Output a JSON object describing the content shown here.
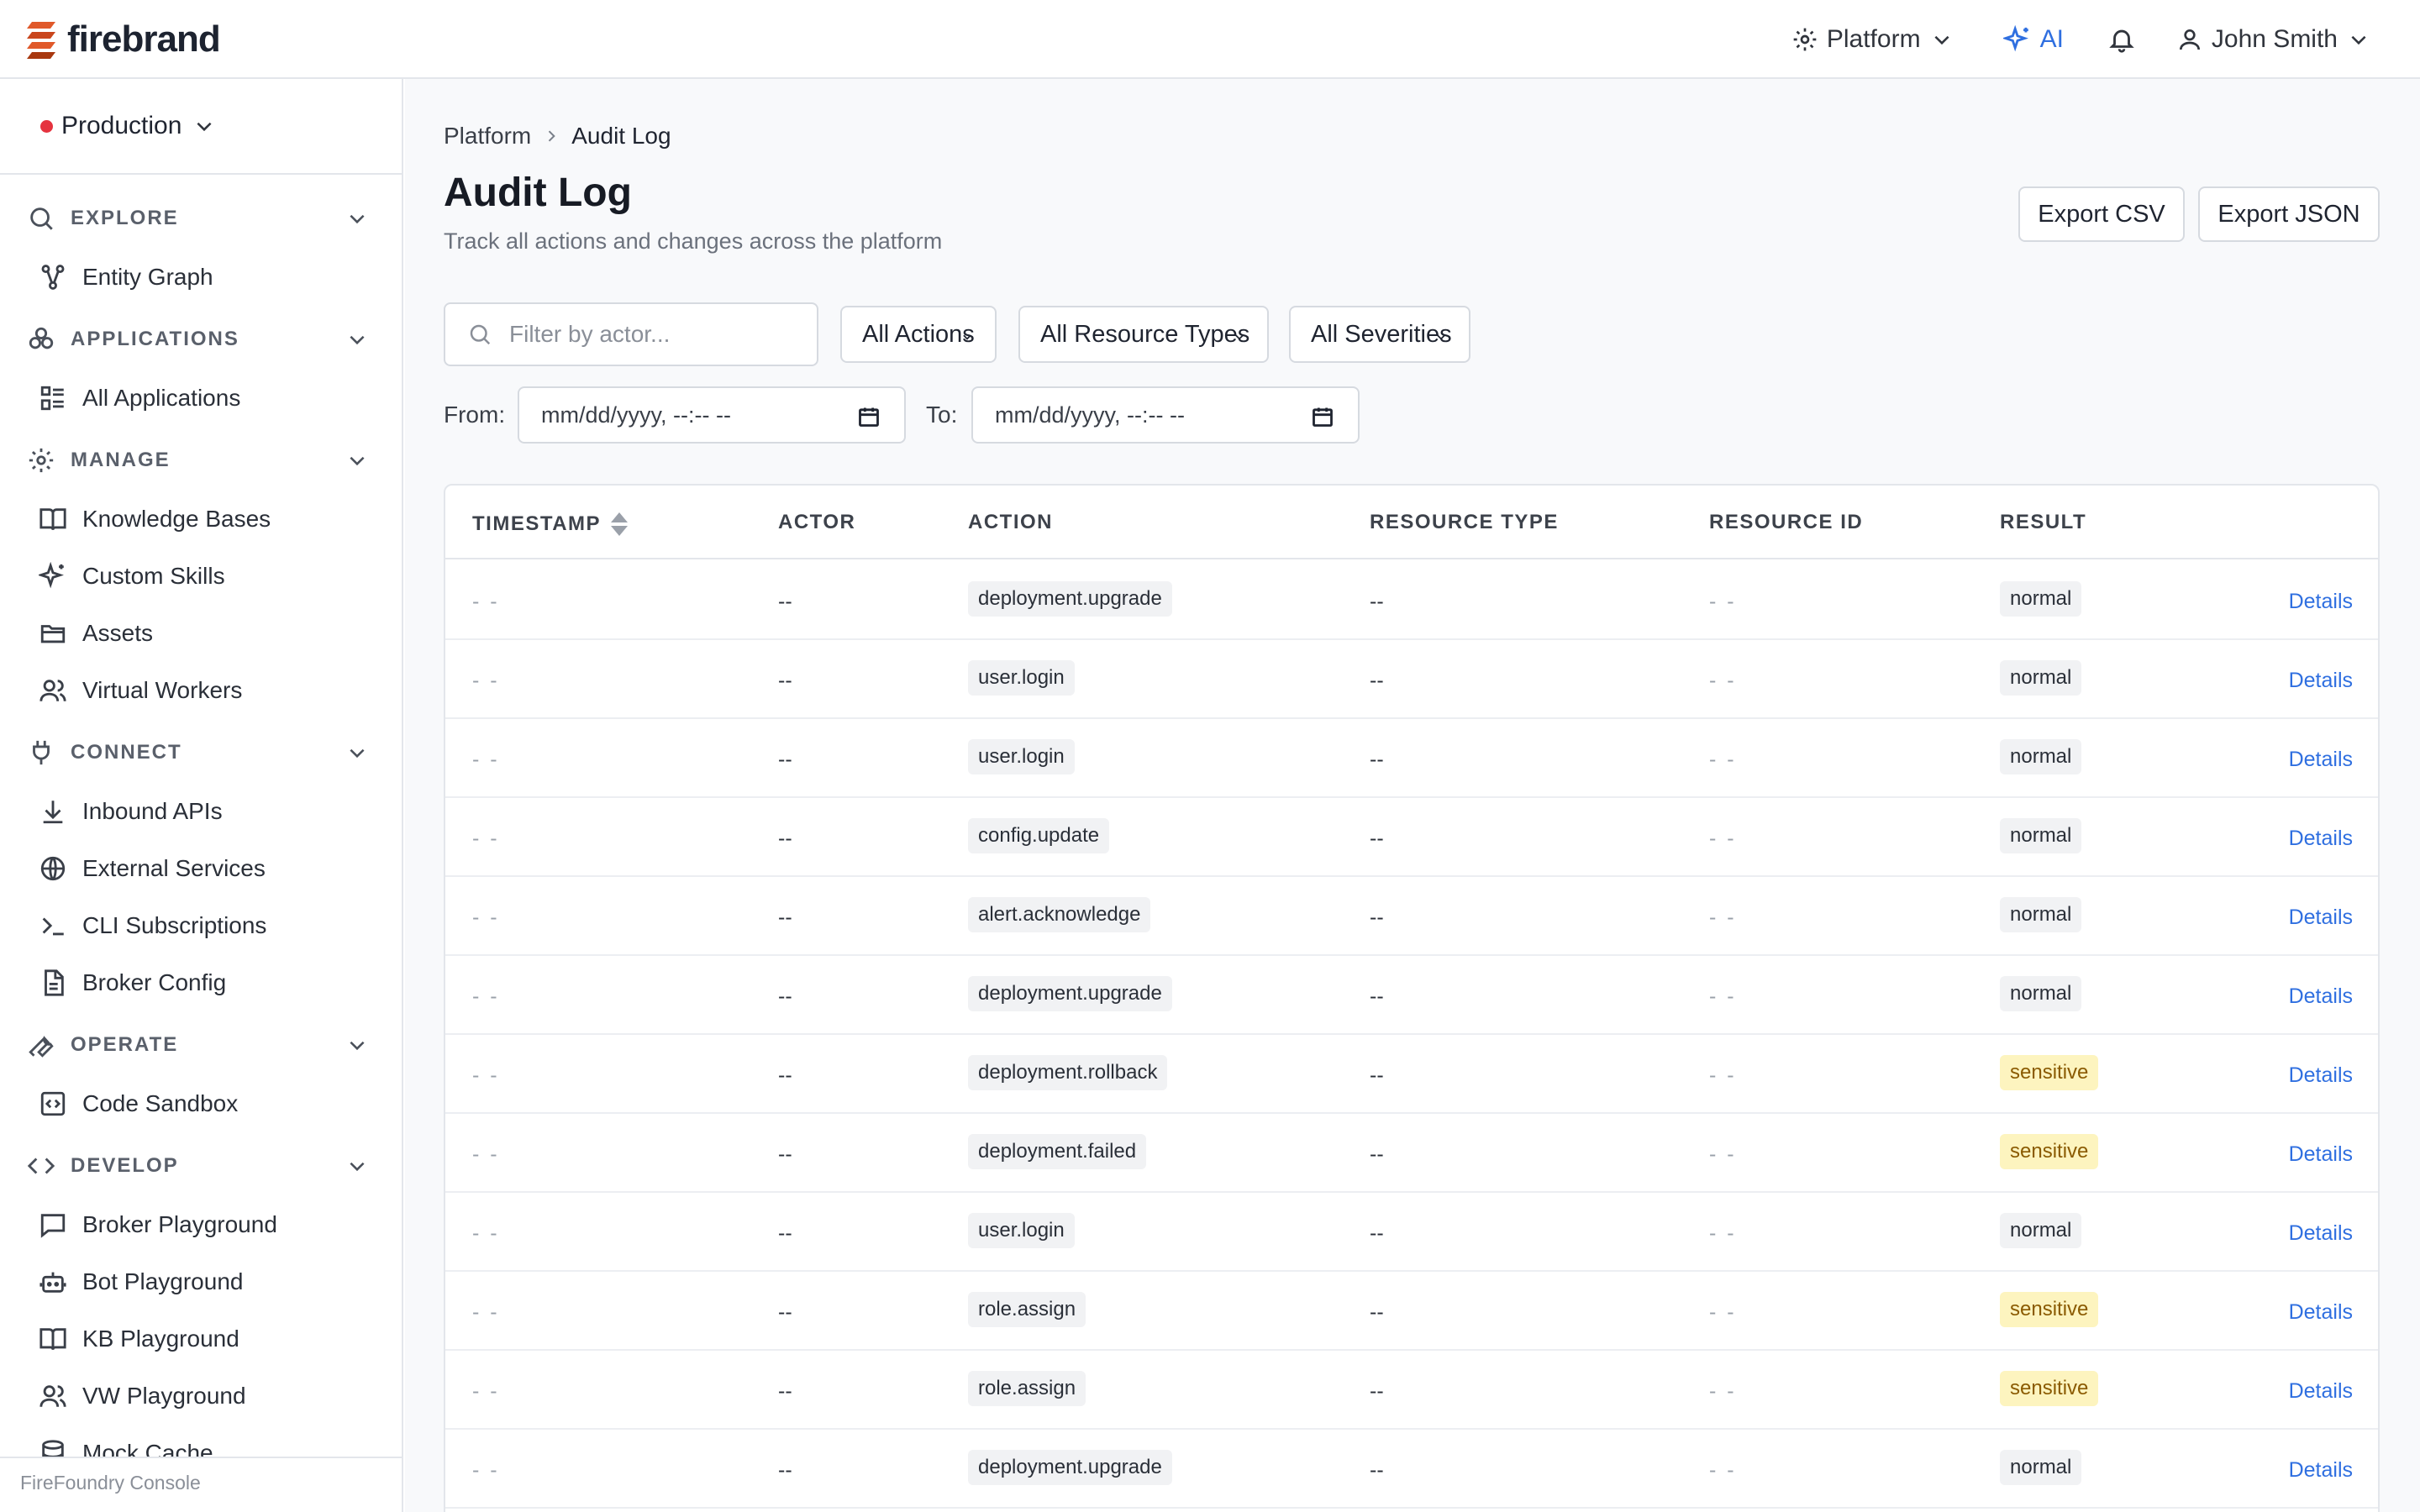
{
  "app": {
    "brand": "firebrand",
    "colors": {
      "accent": "#2f6fe0",
      "brand": "#e0592a",
      "env_dot": "#e5333f",
      "sensitive_bg": "#fdf4bf"
    }
  },
  "topbar": {
    "platform_label": "Platform",
    "ai_label": "AI",
    "user_name": "John Smith"
  },
  "sidebar": {
    "environment": "Production",
    "sections": [
      {
        "label": "EXPLORE",
        "icon": "search-icon",
        "items": [
          {
            "label": "Entity Graph",
            "icon": "graph-icon"
          }
        ]
      },
      {
        "label": "APPLICATIONS",
        "icon": "apps-icon",
        "items": [
          {
            "label": "All Applications",
            "icon": "list-icon"
          }
        ]
      },
      {
        "label": "MANAGE",
        "icon": "gear-icon",
        "items": [
          {
            "label": "Knowledge Bases",
            "icon": "book-icon"
          },
          {
            "label": "Custom Skills",
            "icon": "sparkle-icon"
          },
          {
            "label": "Assets",
            "icon": "folder-icon"
          },
          {
            "label": "Virtual Workers",
            "icon": "users-icon"
          }
        ]
      },
      {
        "label": "CONNECT",
        "icon": "plug-icon",
        "items": [
          {
            "label": "Inbound APIs",
            "icon": "download-icon"
          },
          {
            "label": "External Services",
            "icon": "globe-icon"
          },
          {
            "label": "CLI Subscriptions",
            "icon": "terminal-icon"
          },
          {
            "label": "Broker Config",
            "icon": "file-icon"
          }
        ]
      },
      {
        "label": "OPERATE",
        "icon": "wrench-icon",
        "items": [
          {
            "label": "Code Sandbox",
            "icon": "code-box-icon"
          }
        ]
      },
      {
        "label": "DEVELOP",
        "icon": "code-icon",
        "items": [
          {
            "label": "Broker Playground",
            "icon": "chat-icon"
          },
          {
            "label": "Bot Playground",
            "icon": "bot-icon"
          },
          {
            "label": "KB Playground",
            "icon": "book-icon"
          },
          {
            "label": "VW Playground",
            "icon": "users-icon"
          },
          {
            "label": "Mock Cache",
            "icon": "database-icon"
          }
        ]
      }
    ],
    "footer": "FireFoundry Console"
  },
  "main": {
    "breadcrumb": [
      "Platform",
      "Audit Log"
    ],
    "title": "Audit Log",
    "subtitle": "Track all actions and changes across the platform",
    "export_csv": "Export CSV",
    "export_json": "Export JSON",
    "filters": {
      "actor_placeholder": "Filter by actor...",
      "action": "All Actions",
      "resource_type": "All Resource Types",
      "severity": "All Severities",
      "from_label": "From:",
      "to_label": "To:",
      "date_placeholder": "mm/dd/yyyy, --:-- --"
    },
    "table": {
      "columns": [
        "TIMESTAMP",
        "ACTOR",
        "ACTION",
        "RESOURCE TYPE",
        "RESOURCE ID",
        "RESULT"
      ],
      "details_label": "Details",
      "rows": [
        {
          "timestamp": "- -",
          "actor": "--",
          "action": "deployment.upgrade",
          "resource_type": "--",
          "resource_id": "- -",
          "result": "normal"
        },
        {
          "timestamp": "- -",
          "actor": "--",
          "action": "user.login",
          "resource_type": "--",
          "resource_id": "- -",
          "result": "normal"
        },
        {
          "timestamp": "- -",
          "actor": "--",
          "action": "user.login",
          "resource_type": "--",
          "resource_id": "- -",
          "result": "normal"
        },
        {
          "timestamp": "- -",
          "actor": "--",
          "action": "config.update",
          "resource_type": "--",
          "resource_id": "- -",
          "result": "normal"
        },
        {
          "timestamp": "- -",
          "actor": "--",
          "action": "alert.acknowledge",
          "resource_type": "--",
          "resource_id": "- -",
          "result": "normal"
        },
        {
          "timestamp": "- -",
          "actor": "--",
          "action": "deployment.upgrade",
          "resource_type": "--",
          "resource_id": "- -",
          "result": "normal"
        },
        {
          "timestamp": "- -",
          "actor": "--",
          "action": "deployment.rollback",
          "resource_type": "--",
          "resource_id": "- -",
          "result": "sensitive"
        },
        {
          "timestamp": "- -",
          "actor": "--",
          "action": "deployment.failed",
          "resource_type": "--",
          "resource_id": "- -",
          "result": "sensitive"
        },
        {
          "timestamp": "- -",
          "actor": "--",
          "action": "user.login",
          "resource_type": "--",
          "resource_id": "- -",
          "result": "normal"
        },
        {
          "timestamp": "- -",
          "actor": "--",
          "action": "role.assign",
          "resource_type": "--",
          "resource_id": "- -",
          "result": "sensitive"
        },
        {
          "timestamp": "- -",
          "actor": "--",
          "action": "role.assign",
          "resource_type": "--",
          "resource_id": "- -",
          "result": "sensitive"
        },
        {
          "timestamp": "- -",
          "actor": "--",
          "action": "deployment.upgrade",
          "resource_type": "--",
          "resource_id": "- -",
          "result": "normal"
        }
      ]
    }
  }
}
